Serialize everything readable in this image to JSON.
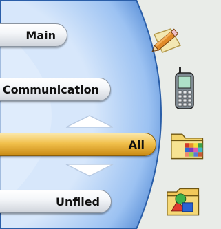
{
  "categories": [
    {
      "label": "Main",
      "selected": false
    },
    {
      "label": "Communication",
      "selected": false
    },
    {
      "label": "All",
      "selected": true
    },
    {
      "label": "Unfiled",
      "selected": false
    }
  ],
  "scroll": {
    "up": "scroll-up-arrow",
    "down": "scroll-down-arrow"
  },
  "icons": [
    "pencil-note-icon",
    "mobile-phone-icon",
    "folder-icon",
    "shapes-folder-icon"
  ],
  "colors": {
    "panel_blue": "#9cc2f2",
    "selected_gold": "#f1c04c",
    "background": "#e9ece8"
  }
}
